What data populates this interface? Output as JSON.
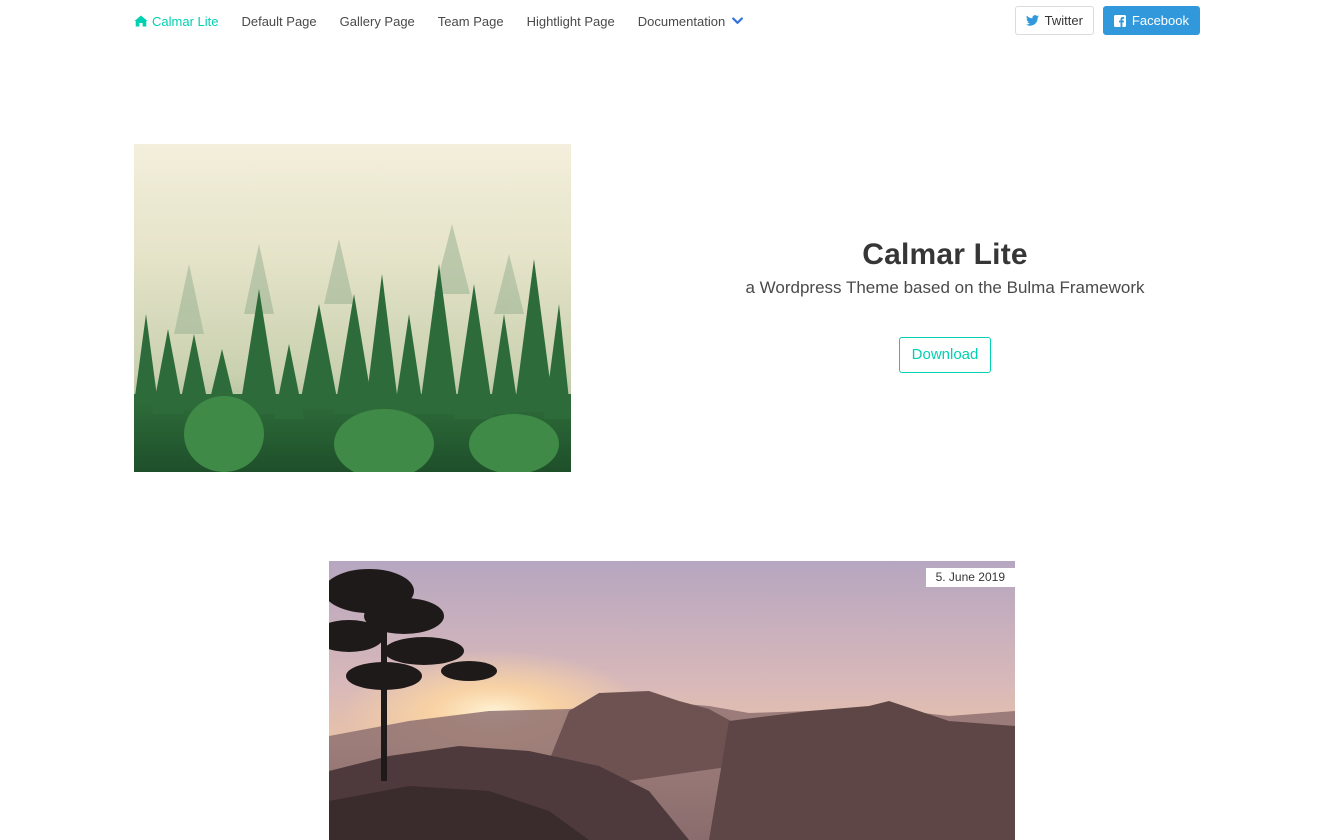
{
  "nav": {
    "brand": {
      "label": "Calmar Lite",
      "icon": "home-icon"
    },
    "items": [
      {
        "label": "Default Page"
      },
      {
        "label": "Gallery Page"
      },
      {
        "label": "Team Page"
      },
      {
        "label": "Hightlight Page"
      },
      {
        "label": "Documentation",
        "icon": "chevron-down-icon"
      }
    ],
    "twitter": {
      "label": "Twitter",
      "icon": "twitter-icon"
    },
    "facebook": {
      "label": "Facebook",
      "icon": "facebook-icon"
    }
  },
  "hero": {
    "title": "Calmar Lite",
    "subtitle": "a Wordpress Theme based on the Bulma Framework",
    "download_label": "Download"
  },
  "post": {
    "date": "5. June 2019"
  },
  "colors": {
    "accent": "#00d1b2",
    "facebook": "#3298dc",
    "text": "#4a4a4a"
  }
}
